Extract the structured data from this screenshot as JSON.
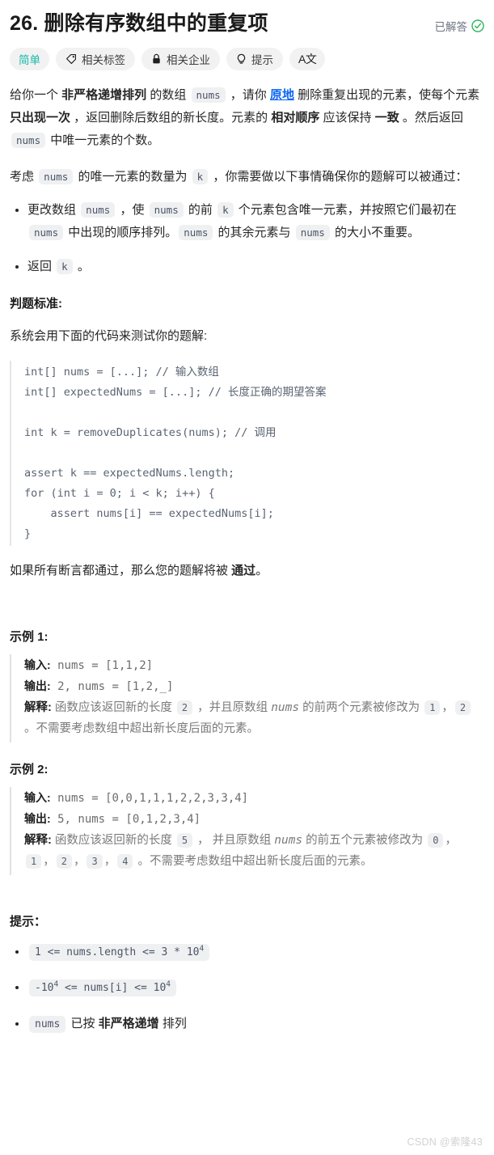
{
  "header": {
    "title": "26. 删除有序数组中的重复项",
    "status_label": "已解答",
    "status_icon": "circle-check-icon",
    "status_color": "#2db55d"
  },
  "badges": [
    {
      "label": "简单",
      "icon": null,
      "name": "difficulty-badge",
      "accent": "#14b8a6"
    },
    {
      "label": "相关标签",
      "icon": "tag-icon",
      "name": "related-topics-button"
    },
    {
      "label": "相关企业",
      "icon": "lock-icon",
      "name": "related-companies-button"
    },
    {
      "label": "提示",
      "icon": "lightbulb-icon",
      "name": "hint-button"
    },
    {
      "label": "A文",
      "icon": "translate-icon",
      "name": "language-toggle-button"
    }
  ],
  "description": {
    "p1": {
      "s1": "给你一个 ",
      "bold1": "非严格递增排列",
      "s2": " 的数组 ",
      "code1": "nums",
      "s3": " ，请你 ",
      "link1": "原地",
      "s4": " 删除重复出现的元素，使每个元素 ",
      "bold2": "只出现一次",
      "s5": " ，返回删除后数组的新长度。元素的 ",
      "bold3": "相对顺序",
      "s6": " 应该保持 ",
      "bold4": "一致",
      "s7": " 。然后返回 ",
      "code2": "nums",
      "s8": " 中唯一元素的个数。"
    },
    "p2": {
      "s1": "考虑 ",
      "code1": "nums",
      "s2": " 的唯一元素的数量为 ",
      "code2": "k",
      "s3": " ，你需要做以下事情确保你的题解可以被通过："
    },
    "bullets": [
      {
        "s1": "更改数组 ",
        "code1": "nums",
        "s2": " ，使 ",
        "code2": "nums",
        "s3": " 的前 ",
        "code3": "k",
        "s4": " 个元素包含唯一元素，并按照它们最初在 ",
        "code4": "nums",
        "s5": " 中出现的顺序排列。",
        "code5": "nums",
        "s6": " 的其余元素与 ",
        "code6": "nums",
        "s7": " 的大小不重要。"
      },
      {
        "s1": "返回 ",
        "code1": "k",
        "s2": " 。"
      }
    ]
  },
  "judge": {
    "heading": "判题标准:",
    "intro": "系统会用下面的代码来测试你的题解:",
    "code": "int[] nums = [...]; // 输入数组\nint[] expectedNums = [...]; // 长度正确的期望答案\n\nint k = removeDuplicates(nums); // 调用\n\nassert k == expectedNums.length;\nfor (int i = 0; i < k; i++) {\n    assert nums[i] == expectedNums[i];\n}",
    "outro_s1": "如果所有断言都通过，那么您的题解将被 ",
    "outro_bold": "通过",
    "outro_s2": "。"
  },
  "examples": [
    {
      "title": "示例 1:",
      "input_label": "输入:",
      "input_value": " nums = [1,1,2]",
      "output_label": "输出:",
      "output_value": " 2, nums = [1,2,_]",
      "explain_label": "解释:",
      "explain": {
        "s1": " 函数应该返回新的长度 ",
        "code1": "2",
        "s2": " ，并且原数组 ",
        "italic1": "nums",
        "s3": " 的前两个元素被修改为 ",
        "code2": "1",
        "s4": "，",
        "code3": "2",
        "s5": " 。不需要考虑数组中超出新长度后面的元素。"
      }
    },
    {
      "title": "示例 2:",
      "input_label": "输入:",
      "input_value": " nums = [0,0,1,1,1,2,2,3,3,4]",
      "output_label": "输出:",
      "output_value": " 5, nums = [0,1,2,3,4]",
      "explain_label": "解释:",
      "explain": {
        "s1": " 函数应该返回新的长度 ",
        "code1": "5",
        "s2": " ， 并且原数组 ",
        "italic1": "nums",
        "s3": " 的前五个元素被修改为 ",
        "code2": "0",
        "s4": "，",
        "code3": "1",
        "s5": "，",
        "code4": "2",
        "s6": "，",
        "code5": "3",
        "s7": "，",
        "code6": "4",
        "s8": " 。不需要考虑数组中超出新长度后面的元素。"
      }
    }
  ],
  "hints": {
    "heading": "提示：",
    "items": [
      {
        "type": "code",
        "pre": "1 <= nums.length <= 3 * 10",
        "sup": "4",
        "post": ""
      },
      {
        "type": "code",
        "pre": "-10",
        "sup": "4",
        "mid": " <= nums[i] <= 10",
        "sup2": "4",
        "post": ""
      },
      {
        "type": "mixed",
        "code1": "nums",
        "s1": " 已按 ",
        "bold1": "非严格递增",
        "s2": " 排列"
      }
    ]
  },
  "watermark": "CSDN @索隆43"
}
